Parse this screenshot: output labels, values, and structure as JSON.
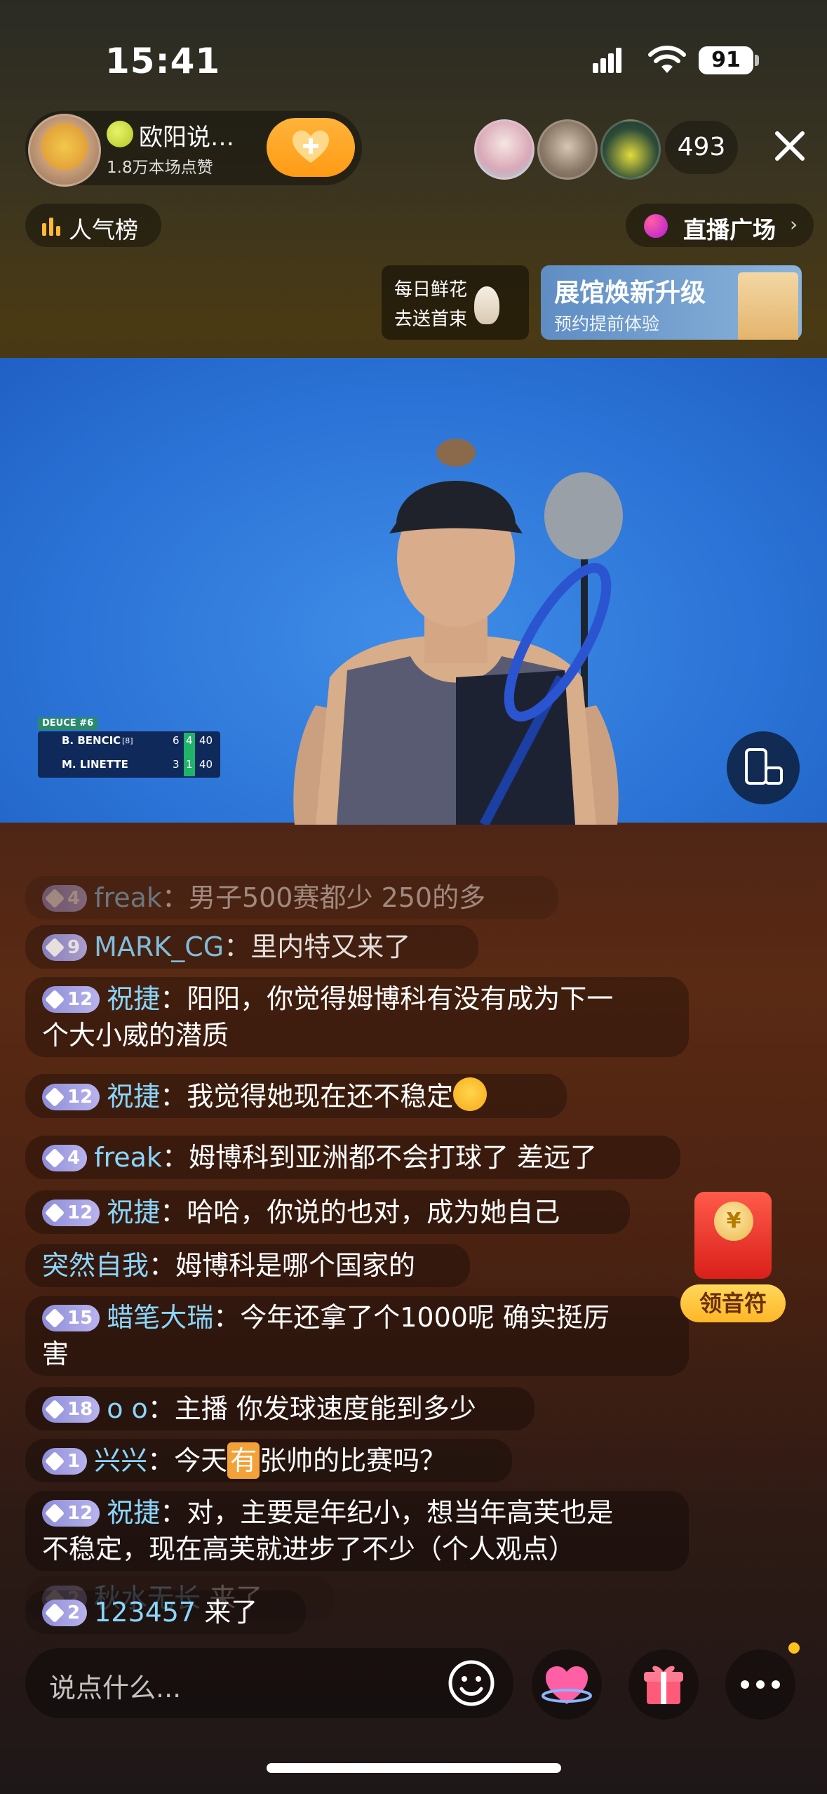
{
  "status_bar": {
    "time": "15:41",
    "battery": "91"
  },
  "host": {
    "name": "欧阳说…",
    "likes": "1.8万本场点赞"
  },
  "viewers": {
    "count": "493"
  },
  "ranking": {
    "label": "人气榜"
  },
  "plaza": {
    "label": "直播广场",
    "chevron": "›"
  },
  "promo": {
    "flower_line1": "每日鲜花",
    "flower_line2": "去送首束",
    "expo_title": "展馆焕新升级",
    "expo_sub": "预约提前体验"
  },
  "scoreboard": {
    "header": "DEUCE #6",
    "players": [
      {
        "name": "B. BENCIC",
        "seed": "[8]",
        "s1": "6",
        "s2": "4",
        "pts": "40"
      },
      {
        "name": "M. LINETTE",
        "seed": "",
        "s1": "3",
        "s2": "1",
        "pts": "40"
      }
    ]
  },
  "chat": [
    {
      "level": "4",
      "user": "freak",
      "text": "男子500赛都少 250的多"
    },
    {
      "level": "9",
      "user": "MARK_CG",
      "text": "里内特又来了"
    },
    {
      "level": "12",
      "user": "祝捷",
      "text": "阳阳，你觉得姆博科有没有成为下一",
      "text2": "个大小威的潜质"
    },
    {
      "level": "12",
      "user": "祝捷",
      "text": "我觉得她现在还不稳定"
    },
    {
      "level": "4",
      "user": "freak",
      "text": "姆博科到亚洲都不会打球了 差远了"
    },
    {
      "level": "12",
      "user": "祝捷",
      "text": "哈哈，你说的也对，成为她自己"
    },
    {
      "level": "",
      "user": "突然自我",
      "text": "姆博科是哪个国家的"
    },
    {
      "level": "15",
      "user": "蜡笔大瑞",
      "text": "今年还拿了个1000呢 确实挺厉",
      "text2": "害"
    },
    {
      "level": "18",
      "user": "o o",
      "text": "主播 你发球速度能到多少"
    },
    {
      "level": "1",
      "user": "兴兴",
      "text_a": "今天",
      "text_tag": "有",
      "text_b": "张帅的比赛吗？"
    },
    {
      "level": "12",
      "user": "祝捷",
      "text": "对，主要是年纪小，想当年高芙也是",
      "text2": "不稳定，现在高芙就进步了不少（个人观点）"
    },
    {
      "level": "2",
      "user": "秋水无长",
      "text": "来了"
    },
    {
      "level": "2",
      "user": "123457",
      "text": "来了"
    }
  ],
  "red_packet": {
    "label": "领音符",
    "coin": "¥"
  },
  "input": {
    "placeholder": "说点什么..."
  },
  "colors": {
    "accent": "#ffb33a",
    "username": "#8ad6ff",
    "badge": "#a9a5e6"
  }
}
